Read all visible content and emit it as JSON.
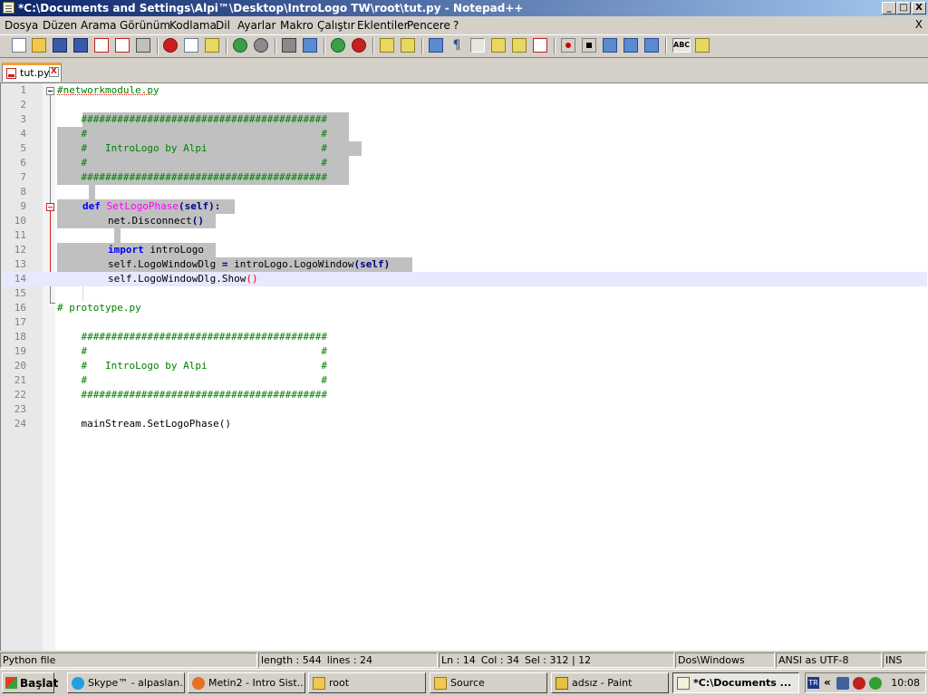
{
  "window": {
    "title": "*C:\\Documents and Settings\\Alpi™\\Desktop\\IntroLogo TW\\root\\tut.py - Notepad++",
    "controls": {
      "minimize": "_",
      "maximize": "□",
      "close": "X"
    }
  },
  "menu": {
    "items": [
      "Dosya",
      "Düzen",
      "Arama",
      "Görünüm",
      "Kodlama",
      "Dil",
      "Ayarlar",
      "Makro",
      "Çalıştır",
      "Eklentiler",
      "Pencere",
      "?"
    ],
    "close": "X"
  },
  "toolbar": {
    "icons": [
      "new-file-icon",
      "open-folder-icon",
      "save-icon",
      "save-all-icon",
      "close-file-icon",
      "close-all-icon",
      "print-icon",
      "cut-icon",
      "copy-icon",
      "paste-icon",
      "undo-icon",
      "redo-icon",
      "find-icon",
      "replace-icon",
      "zoom-in-icon",
      "zoom-out-icon",
      "sync-vertical-icon",
      "sync-horizontal-icon",
      "word-wrap-icon",
      "show-all-chars-icon",
      "indent-guide-icon",
      "user-defined-lang-icon",
      "doc-map-icon",
      "function-list-icon",
      "record-macro-icon",
      "stop-record-icon",
      "play-macro-icon",
      "run-macro-multiple-icon",
      "save-macro-icon",
      "spell-check-icon",
      "plugin-icon"
    ]
  },
  "tabs": [
    {
      "label": "tut.py",
      "close": "X"
    }
  ],
  "editor": {
    "lines": [
      {
        "n": "1",
        "text": "#networkmodule.py"
      },
      {
        "n": "2",
        "text": ""
      },
      {
        "n": "3",
        "text": "    #########################################"
      },
      {
        "n": "4",
        "text": "    #                                       #"
      },
      {
        "n": "5",
        "text": "    #   IntroLogo by Alpi                   #"
      },
      {
        "n": "6",
        "text": "    #                                       #"
      },
      {
        "n": "7",
        "text": "    #########################################"
      },
      {
        "n": "8",
        "text": ""
      },
      {
        "n": "9",
        "text": "def SetLogoPhase(self):"
      },
      {
        "n": "10",
        "text": "net.Disconnect()"
      },
      {
        "n": "11",
        "text": ""
      },
      {
        "n": "12",
        "text": "import introLogo"
      },
      {
        "n": "13",
        "text": "self.LogoWindowDlg = introLogo.LogoWindow(self)"
      },
      {
        "n": "14",
        "text": "self.LogoWindowDlg.Show()"
      },
      {
        "n": "15",
        "text": ""
      },
      {
        "n": "16",
        "text": "# prototype.py"
      },
      {
        "n": "17",
        "text": ""
      },
      {
        "n": "18",
        "text": "    #########################################"
      },
      {
        "n": "19",
        "text": "    #                                       #"
      },
      {
        "n": "20",
        "text": "    #   IntroLogo by Alpi                   #"
      },
      {
        "n": "21",
        "text": "    #                                       #"
      },
      {
        "n": "22",
        "text": "    #########################################"
      },
      {
        "n": "23",
        "text": ""
      },
      {
        "n": "24",
        "text": "    mainStream.SetLogoPhase()"
      }
    ],
    "current_line": 14
  },
  "status": {
    "lang": "Python file",
    "length": "length : 544",
    "lines": "lines : 24",
    "ln": "Ln : 14",
    "col": "Col : 34",
    "sel": "Sel : 312 | 12",
    "eol": "Dos\\Windows",
    "encoding": "ANSI as UTF-8",
    "mode": "INS"
  },
  "taskbar": {
    "start": "Başlat",
    "buttons": [
      {
        "label": "Skype™ - alpaslan...",
        "icon": "skype-icon"
      },
      {
        "label": "Metin2 - Intro Sist...",
        "icon": "firefox-icon"
      },
      {
        "label": "root",
        "icon": "folder-icon"
      },
      {
        "label": "Source",
        "icon": "folder-icon"
      },
      {
        "label": "adsız - Paint",
        "icon": "paint-icon"
      },
      {
        "label": "*C:\\Documents ...",
        "icon": "notepad-icon"
      }
    ],
    "tray": {
      "lang": "TR",
      "expand": "«",
      "clock": "10:08"
    }
  },
  "colors": {
    "comment": "#008000",
    "keyword": "#0000ff",
    "function": "#ff00ff",
    "selection": "#c0c0c0",
    "current_line": "#e8e8ff"
  }
}
